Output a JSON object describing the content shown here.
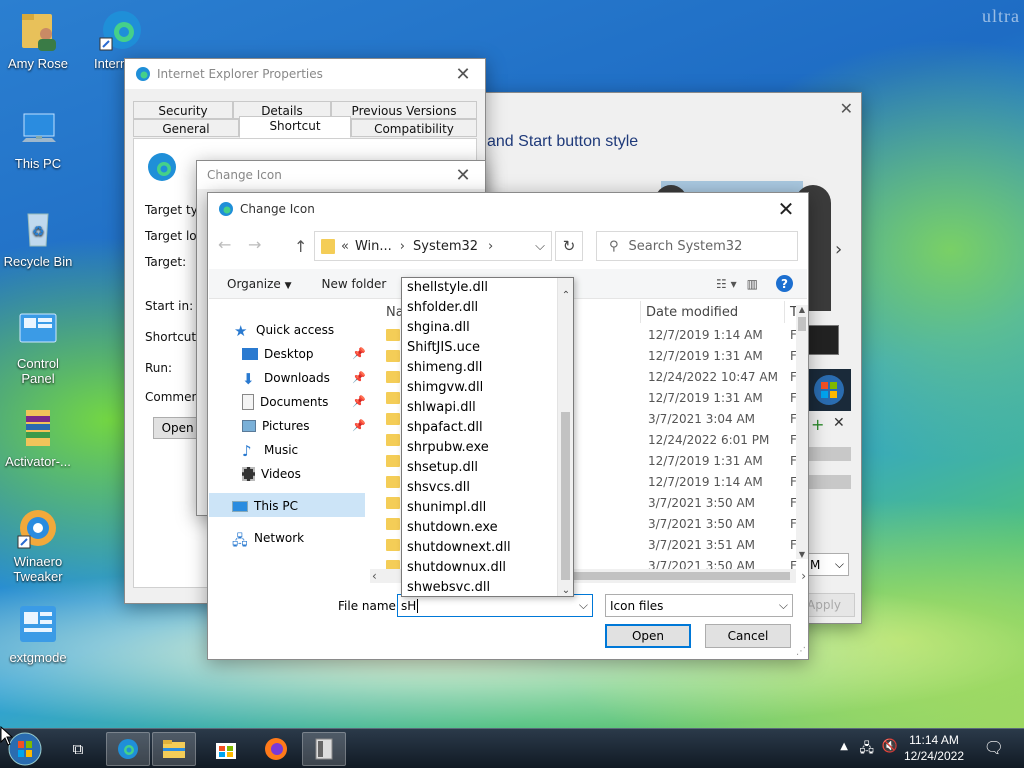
{
  "desktop": {
    "watermark": "ultra",
    "icons": [
      {
        "label": "Amy Rose"
      },
      {
        "label": "This PC"
      },
      {
        "label": "Recycle Bin"
      },
      {
        "label": "Control Panel"
      },
      {
        "label": "Activator-..."
      },
      {
        "label": "Winaero Tweaker"
      },
      {
        "label": "extgmode"
      },
      {
        "label": "Intern Explo"
      }
    ]
  },
  "background_window": {
    "heading": "and Start button style",
    "nav_arrow": "›",
    "bottom_combo_value": "M",
    "apply_label": "Apply"
  },
  "ie_properties": {
    "title": "Internet Explorer Properties",
    "tabs_row1": [
      "Security",
      "Details",
      "Previous Versions"
    ],
    "tabs_row2": [
      "General",
      "Shortcut",
      "Compatibility"
    ],
    "selected_tab": "Shortcut",
    "labels": [
      "Target type:",
      "Target loca",
      "Target:",
      "Start in:",
      "Shortcut ke",
      "Run:",
      "Comment:"
    ],
    "open_button": "Open F"
  },
  "change_icon_back": {
    "title": "Change Icon"
  },
  "change_icon": {
    "title": "Change Icon",
    "address": {
      "prefix": "«",
      "crumbs": [
        "Win...",
        "System32"
      ],
      "separator": "›"
    },
    "search_placeholder": "Search System32",
    "toolbar": {
      "organize": "Organize",
      "new_folder": "New folder"
    },
    "nav": {
      "quick_access": "Quick access",
      "items": [
        "Desktop",
        "Downloads",
        "Documents",
        "Pictures",
        "Music",
        "Videos"
      ],
      "this_pc": "This PC",
      "network": "Network"
    },
    "columns": {
      "name": "Na",
      "date_modified": "Date modified",
      "type": "T"
    },
    "rows": [
      {
        "date": "12/7/2019 1:14 AM",
        "type": "F"
      },
      {
        "date": "12/7/2019 1:31 AM",
        "type": "F"
      },
      {
        "date": "12/24/2022 10:47 AM",
        "type": "F"
      },
      {
        "date": "12/7/2019 1:31 AM",
        "type": "F"
      },
      {
        "date": "3/7/2021 3:04 AM",
        "type": "F"
      },
      {
        "date": "12/24/2022 6:01 PM",
        "type": "F"
      },
      {
        "date": "12/7/2019 1:31 AM",
        "type": "F"
      },
      {
        "date": "12/7/2019 1:14 AM",
        "type": "F"
      },
      {
        "date": "3/7/2021 3:50 AM",
        "type": "F"
      },
      {
        "date": "3/7/2021 3:50 AM",
        "type": "F"
      },
      {
        "date": "3/7/2021 3:51 AM",
        "type": "F"
      },
      {
        "date": "3/7/2021 3:50 AM",
        "type": "F"
      }
    ],
    "autocomplete": [
      "shellstyle.dll",
      "shfolder.dll",
      "shgina.dll",
      "ShiftJIS.uce",
      "shimeng.dll",
      "shimgvw.dll",
      "shlwapi.dll",
      "shpafact.dll",
      "shrpubw.exe",
      "shsetup.dll",
      "shsvcs.dll",
      "shunimpl.dll",
      "shutdown.exe",
      "shutdownext.dll",
      "shutdownux.dll",
      "shwebsvc.dll"
    ],
    "file_name_label": "File name:",
    "file_name_value": "sH",
    "file_type": "Icon files",
    "open_button": "Open",
    "cancel_button": "Cancel"
  },
  "taskbar": {
    "time": "11:14 AM",
    "date": "12/24/2022"
  }
}
